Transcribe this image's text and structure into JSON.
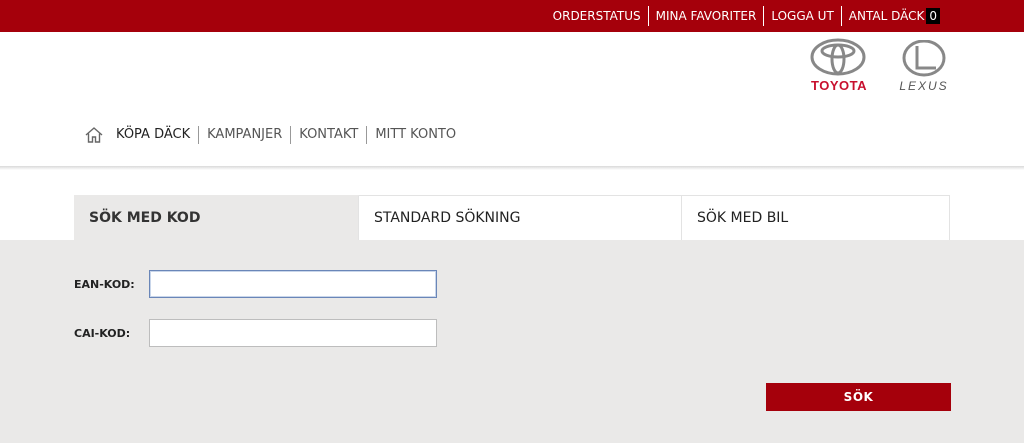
{
  "topnav": {
    "order_status": "ORDERSTATUS",
    "favorites": "MINA FAVORITER",
    "logout": "LOGGA UT",
    "tire_count_label": "ANTAL DÄCK",
    "tire_count": "0"
  },
  "brands": {
    "toyota": "TOYOTA",
    "lexus": "LEXUS"
  },
  "mainnav": {
    "items": [
      "KÖPA DÄCK",
      "KAMPANJER",
      "KONTAKT",
      "MITT KONTO"
    ]
  },
  "tabs": [
    {
      "label": "SÖK MED KOD",
      "active": true
    },
    {
      "label": "STANDARD SÖKNING",
      "active": false
    },
    {
      "label": "SÖK MED BIL",
      "active": false
    }
  ],
  "form": {
    "ean_label": "EAN-KOD:",
    "ean_value": "",
    "cai_label": "CAI-KOD:",
    "cai_value": "",
    "submit_label": "SÖK"
  },
  "colors": {
    "brand_red": "#a5000b",
    "panel_bg": "#eae9e8"
  }
}
